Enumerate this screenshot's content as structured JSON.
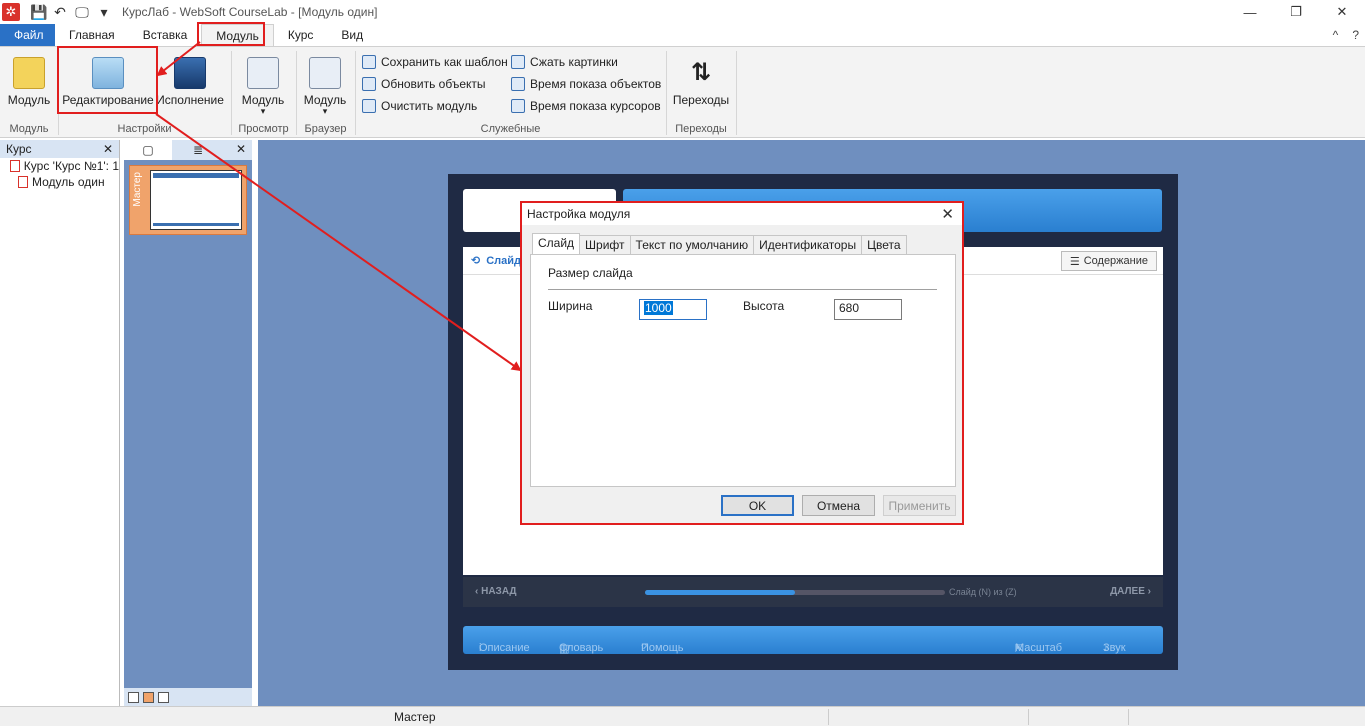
{
  "window": {
    "title": "КурсЛаб - WebSoft CourseLab - [Модуль один]",
    "controls": {
      "minimize": "—",
      "restore": "❐",
      "close": "✕"
    }
  },
  "menu": {
    "file": "Файл",
    "tabs": [
      "Главная",
      "Вставка",
      "Модуль",
      "Курс",
      "Вид"
    ],
    "active_tab": "Модуль",
    "right_controls": [
      "^",
      "?"
    ]
  },
  "ribbon": {
    "module_btn": "Модуль",
    "edit_btn": "Редактирование",
    "run_btn": "Исполнение",
    "view_btn": "Модуль",
    "browser_btn": "Модуль",
    "transitions_btn": "Переходы",
    "groups": {
      "module": "Модуль",
      "settings": "Настройки",
      "view": "Просмотр",
      "browser": "Браузер",
      "service": "Служебные",
      "transitions": "Переходы"
    },
    "service_cmds": [
      "Сохранить как шаблон",
      "Обновить объекты",
      "Очистить модуль",
      "Сжать картинки",
      "Время показа объектов",
      "Время показа курсоров"
    ],
    "dropdown_mark": "▾"
  },
  "left_panel": {
    "header": "Курс",
    "close": "✕",
    "tree": [
      {
        "label": "Курс 'Курс №1': 1"
      },
      {
        "label": "Модуль один"
      }
    ]
  },
  "slides_panel": {
    "thumb_label": "Мастер",
    "close": "✕"
  },
  "stage": {
    "slide_tab": "Слайд",
    "contents_btn": "Содержание",
    "nav_back": "НАЗАД",
    "nav_next": "ДАЛЕЕ",
    "progress_text": "Слайд (N) из (Z)",
    "progress_fraction": 0.5,
    "footer": {
      "description": "Описание",
      "glossary": "Словарь",
      "help": "Помощь",
      "scale": "Масштаб",
      "sound": "Звук"
    }
  },
  "dialog": {
    "title": "Настройка модуля",
    "tabs": [
      "Слайд",
      "Шрифт",
      "Текст по умолчанию",
      "Идентификаторы",
      "Цвета"
    ],
    "active_tab": "Слайд",
    "section": "Размер слайда",
    "width_label": "Ширина",
    "width_value": "1000",
    "height_label": "Высота",
    "height_value": "680",
    "ok": "OK",
    "cancel": "Отмена",
    "apply": "Применить"
  },
  "statusbar": {
    "text": "Мастер"
  },
  "colors": {
    "accent": "#2a71c6",
    "annotation": "#e11e1e",
    "canvas": "#6f8fbf"
  }
}
